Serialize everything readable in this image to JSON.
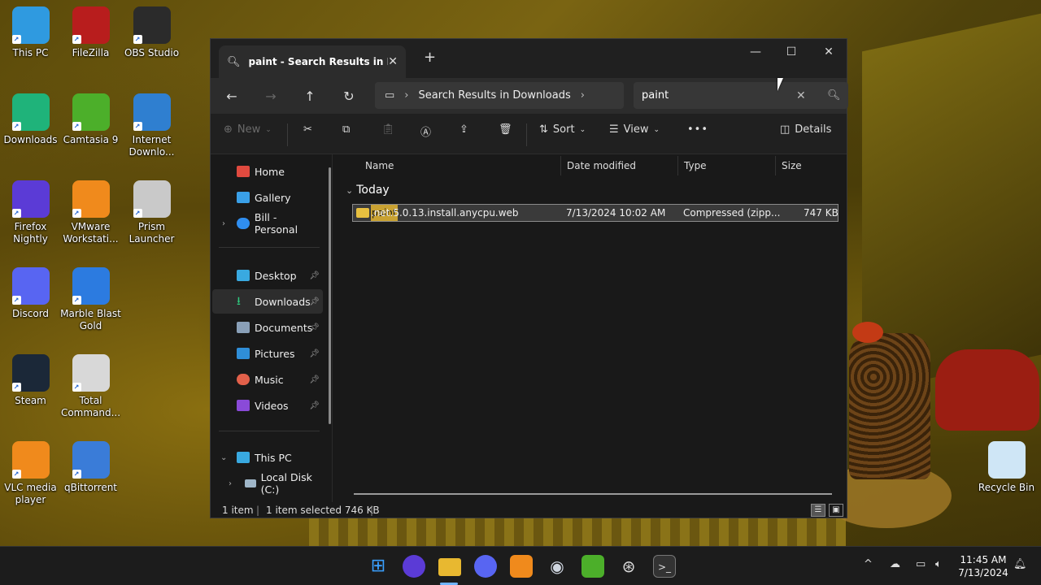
{
  "desktop": {
    "icons": [
      {
        "label": "This PC",
        "icon": "this-pc-icon",
        "color": "#2f9ae0"
      },
      {
        "label": "FileZilla",
        "icon": "filezilla-icon",
        "color": "#b81d1d"
      },
      {
        "label": "OBS Studio",
        "icon": "obs-studio-icon",
        "color": "#2b2b2b"
      },
      {
        "label": "Downloads",
        "icon": "downloads-folder-icon",
        "color": "#1fb37a"
      },
      {
        "label": "Camtasia 9",
        "icon": "camtasia-icon",
        "color": "#4caf2a"
      },
      {
        "label": "Internet Downlo...",
        "icon": "internet-download-manager-icon",
        "color": "#2f7fd0"
      },
      {
        "label": "Firefox Nightly",
        "icon": "firefox-nightly-icon",
        "color": "#5b3bd6"
      },
      {
        "label": "VMware Workstati...",
        "icon": "vmware-icon",
        "color": "#f08a1c"
      },
      {
        "label": "Prism Launcher",
        "icon": "prism-launcher-icon",
        "color": "#c9c9c9"
      },
      {
        "label": "Discord",
        "icon": "discord-icon",
        "color": "#5865f2"
      },
      {
        "label": "Marble Blast Gold",
        "icon": "marble-blast-icon",
        "color": "#2c7be0"
      },
      {
        "label": "Steam",
        "icon": "steam-icon",
        "color": "#1b2838"
      },
      {
        "label": "Total Command...",
        "icon": "total-commander-icon",
        "color": "#d8d8d8"
      },
      {
        "label": "VLC media player",
        "icon": "vlc-icon",
        "color": "#f08a1c"
      },
      {
        "label": "qBittorrent",
        "icon": "qbittorrent-icon",
        "color": "#3a7cd8"
      },
      {
        "label": "Recycle Bin",
        "icon": "recycle-bin-icon",
        "color": "#cfe6f6"
      }
    ]
  },
  "explorer": {
    "tab_title": "paint - Search Results in Down",
    "address": {
      "segment": "Search Results in Downloads"
    },
    "search": {
      "value": "paint"
    },
    "toolbar": {
      "new": "New",
      "sort": "Sort",
      "view": "View",
      "more": "•••",
      "details": "Details"
    },
    "sidebar": {
      "home": "Home",
      "gallery": "Gallery",
      "onedrive": "Bill - Personal",
      "desktop": "Desktop",
      "downloads": "Downloads",
      "documents": "Documents",
      "pictures": "Pictures",
      "music": "Music",
      "videos": "Videos",
      "this_pc": "This PC",
      "local_disk": "Local Disk (C:)"
    },
    "columns": {
      "name": "Name",
      "date": "Date modified",
      "type": "Type",
      "size": "Size"
    },
    "group": "Today",
    "file": {
      "name_highlight": "paint",
      "name_rest": ".net.5.0.13.install.anycpu.web",
      "date": "7/13/2024 10:02 AM",
      "type": "Compressed (zipp...",
      "size": "747 KB"
    },
    "status": {
      "items": "1 item",
      "selected": "1 item selected  746 KB"
    }
  },
  "taskbar": {
    "time": "11:45 AM",
    "date": "7/13/2024"
  }
}
